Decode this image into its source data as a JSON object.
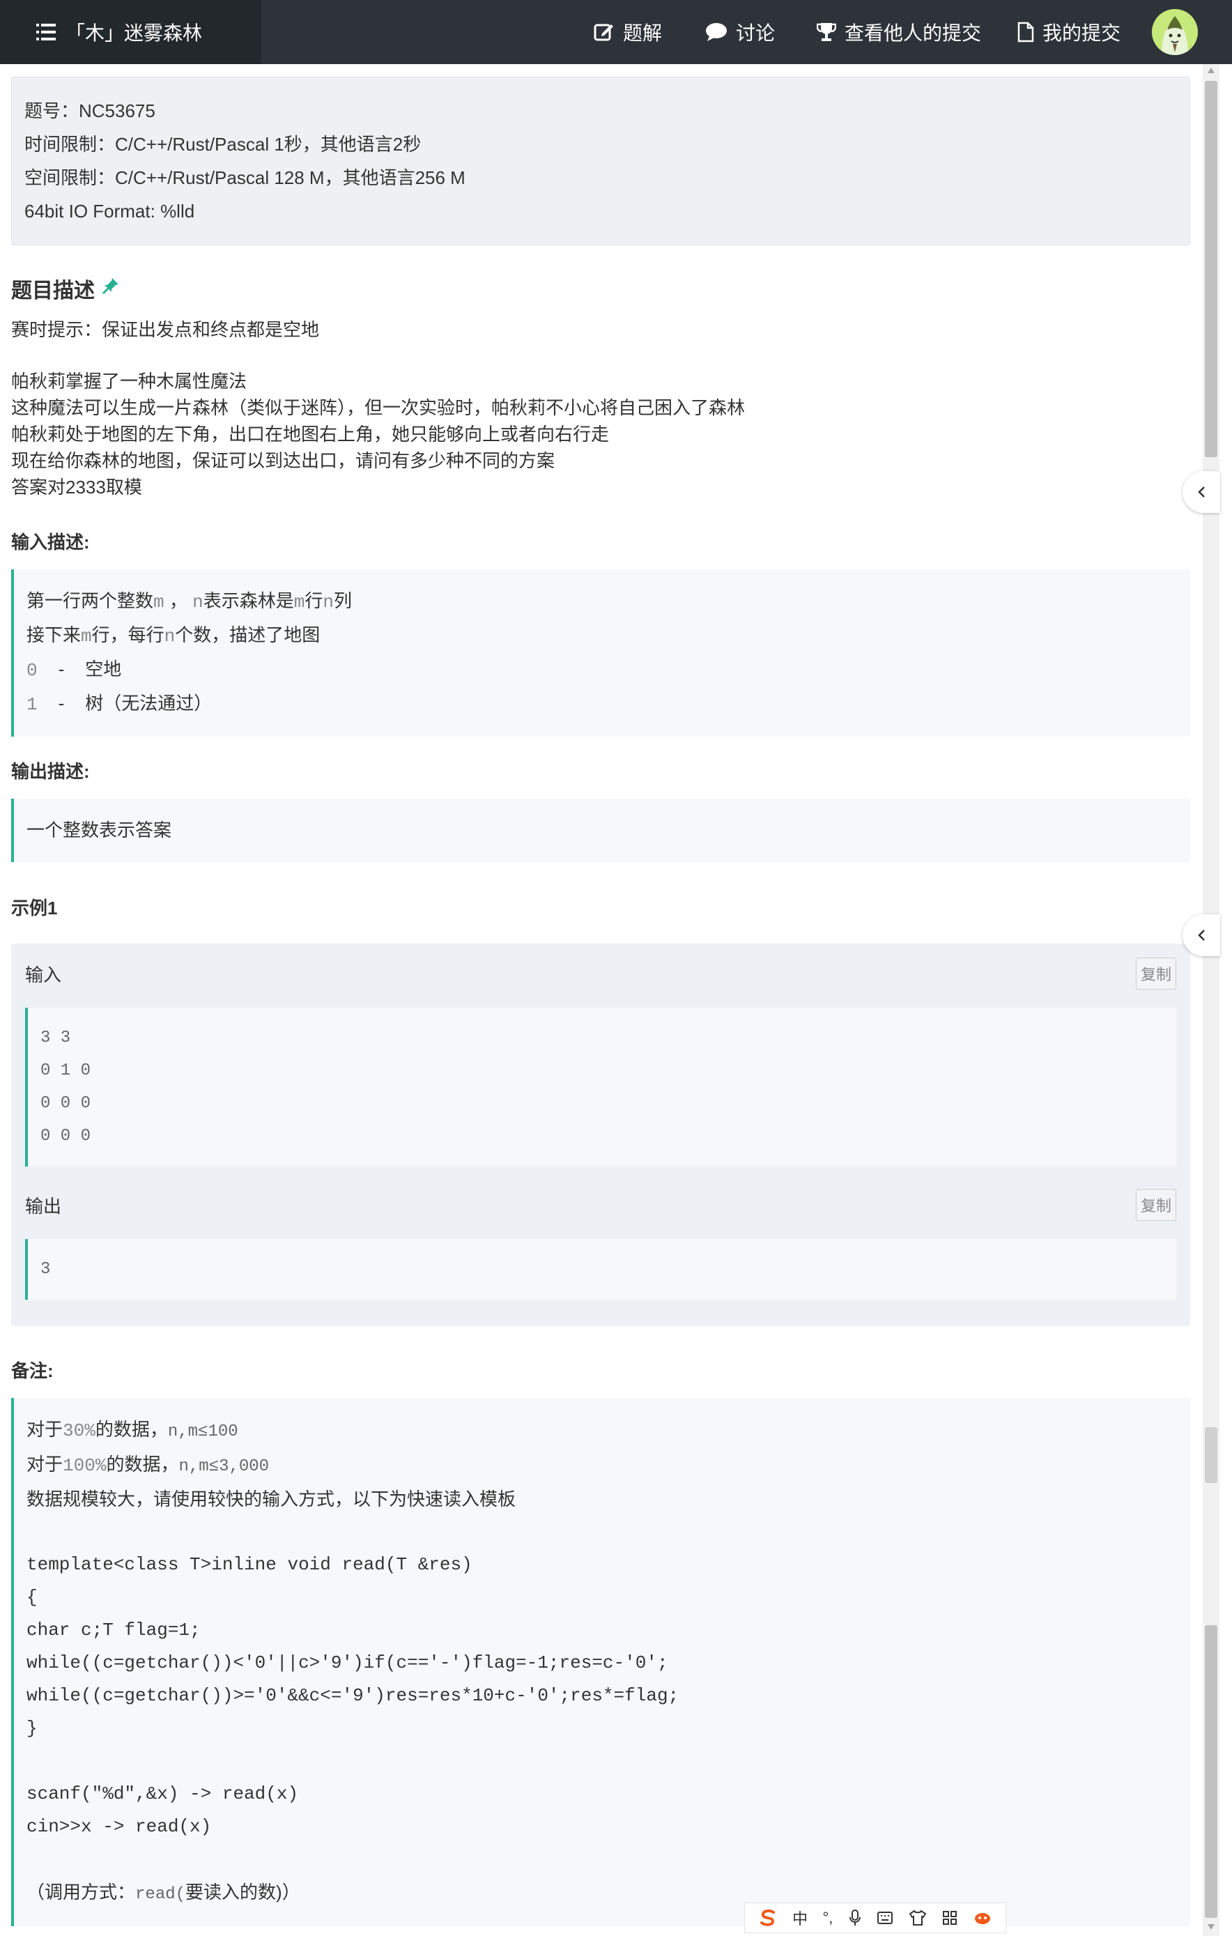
{
  "nav": {
    "title": "「木」迷雾森林",
    "items": [
      "题解",
      "讨论",
      "查看他人的提交",
      "我的提交"
    ]
  },
  "meta": {
    "id": "题号：NC53675",
    "time": "时间限制：C/C++/Rust/Pascal 1秒，其他语言2秒",
    "space": "空间限制：C/C++/Rust/Pascal 128 M，其他语言256 M",
    "io": "64bit IO Format: %lld"
  },
  "desc": {
    "title": "题目描述",
    "hint": "赛时提示：保证出发点和终点都是空地",
    "lines": [
      "帕秋莉掌握了一种木属性魔法",
      "这种魔法可以生成一片森林（类似于迷阵），但一次实验时，帕秋莉不小心将自己困入了森林",
      "帕秋莉处于地图的左下角，出口在地图右上角，她只能够向上或者向右行走",
      "现在给你森林的地图，保证可以到达出口，请问有多少种不同的方案",
      "答案对2333取模"
    ]
  },
  "input": {
    "title": "输入描述:",
    "l1": {
      "a": "第一行两个整数",
      "m": "m",
      "comma": " ， ",
      "n": "n",
      "b": "表示森林是",
      "m2": "m",
      "c": "行",
      "n2": "n",
      "d": "列"
    },
    "l2": {
      "a": "接下来",
      "m": "m",
      "b": "行，每行",
      "n": "n",
      "c": "个数，描述了地图"
    },
    "l3": {
      "num": "0",
      "dash": "-",
      "text": "空地"
    },
    "l4": {
      "num": "1",
      "dash": "-",
      "text": "树（无法通过）"
    }
  },
  "output": {
    "title": "输出描述:",
    "text": "一个整数表示答案"
  },
  "sample": {
    "title": "示例1",
    "in_label": "输入",
    "out_label": "输出",
    "copy": "复制",
    "input_lines": [
      "3 3",
      "0 1 0",
      "0 0 0",
      "0 0 0"
    ],
    "output_lines": [
      "3"
    ]
  },
  "notes": {
    "title": "备注:",
    "l1": {
      "a": "对于",
      "pct": "30%",
      "b": "的数据，",
      "expr": "n,m≤100"
    },
    "l2": {
      "a": "对于",
      "pct": "100%",
      "b": "的数据，",
      "expr": "n,m≤3,000"
    },
    "l3": "数据规模较大，请使用较快的输入方式，以下为快速读入模板",
    "code": [
      "template<class T>inline void read(T &res)",
      "{",
      "char c;T flag=1;",
      "while((c=getchar())<'0'||c>'9')if(c=='-')flag=-1;res=c-'0';",
      "while((c=getchar())>='0'&&c<='9')res=res*10+c-'0';res*=flag;",
      "}"
    ],
    "code2": [
      "scanf(\"%d\",&x)  ->  read(x)",
      "cin>>x -> read(x)"
    ],
    "call": {
      "a": "（调用方式：",
      "code": "read(",
      "b": "要读入的数",
      "c": ")）"
    }
  },
  "ime": {
    "zh": "中",
    "punct": "°,"
  },
  "colors": {
    "nav_bg": "#2d3339",
    "accent": "#27b195"
  }
}
